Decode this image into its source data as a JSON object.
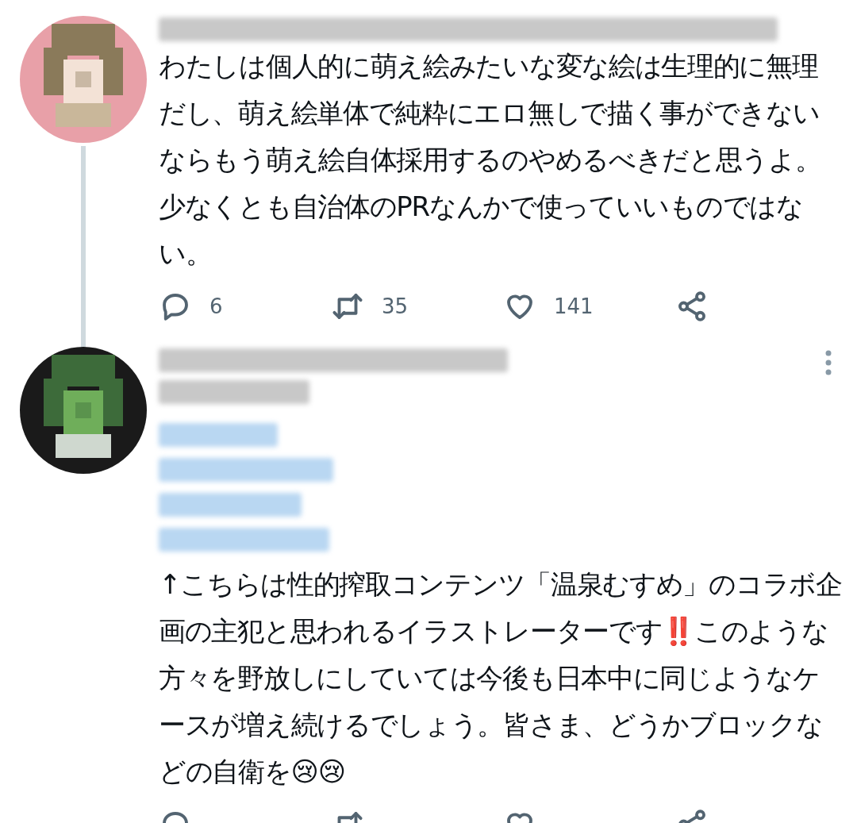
{
  "tweets": [
    {
      "text": "わたしは個人的に萌え絵みたいな変な絵は生理的に無理だし、萌え絵単体で純粋にエロ無しで描く事ができないならもう萌え絵自体採用するのやめるべきだと思うよ。少なくとも自治体のPRなんかで使っていいものではない。",
      "thread_line": true,
      "more_menu": false,
      "actions": [
        {
          "kind": "reply",
          "count": "6"
        },
        {
          "kind": "retweet",
          "count": "35"
        },
        {
          "kind": "like",
          "count": "141"
        },
        {
          "kind": "share"
        }
      ]
    },
    {
      "text": "↑こちらは性的搾取コンテンツ「温泉むすめ」のコラボ企画の主犯と思われるイラストレーターです‼️このような方々を野放しにしていては今後も日本中に同じようなケースが増え続けるでしょう。皆さま、どうかブロックなどの自衛を😢😢",
      "thread_line": false,
      "more_menu": true,
      "actions": [
        {
          "kind": "reply"
        },
        {
          "kind": "retweet"
        },
        {
          "kind": "like"
        },
        {
          "kind": "share"
        }
      ]
    }
  ]
}
